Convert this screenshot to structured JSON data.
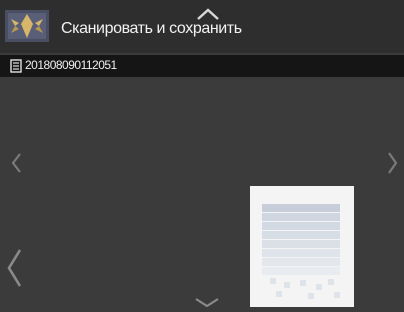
{
  "header": {
    "title": "Сканировать и сохранить",
    "logo_icon": "scan-app-logo-icon",
    "collapse_icon": "chevron-up-icon"
  },
  "document": {
    "name": "201808090112051",
    "icon": "document-icon"
  },
  "navigation": {
    "prev_icon": "chevron-left-icon",
    "next_icon": "chevron-right-icon",
    "scroll_down_icon": "chevron-down-icon"
  },
  "colors": {
    "header_bg": "#2e2e2e",
    "doc_bar_bg": "#151515",
    "content_bg": "#3b3b3b",
    "accent": "#c9a85a"
  }
}
